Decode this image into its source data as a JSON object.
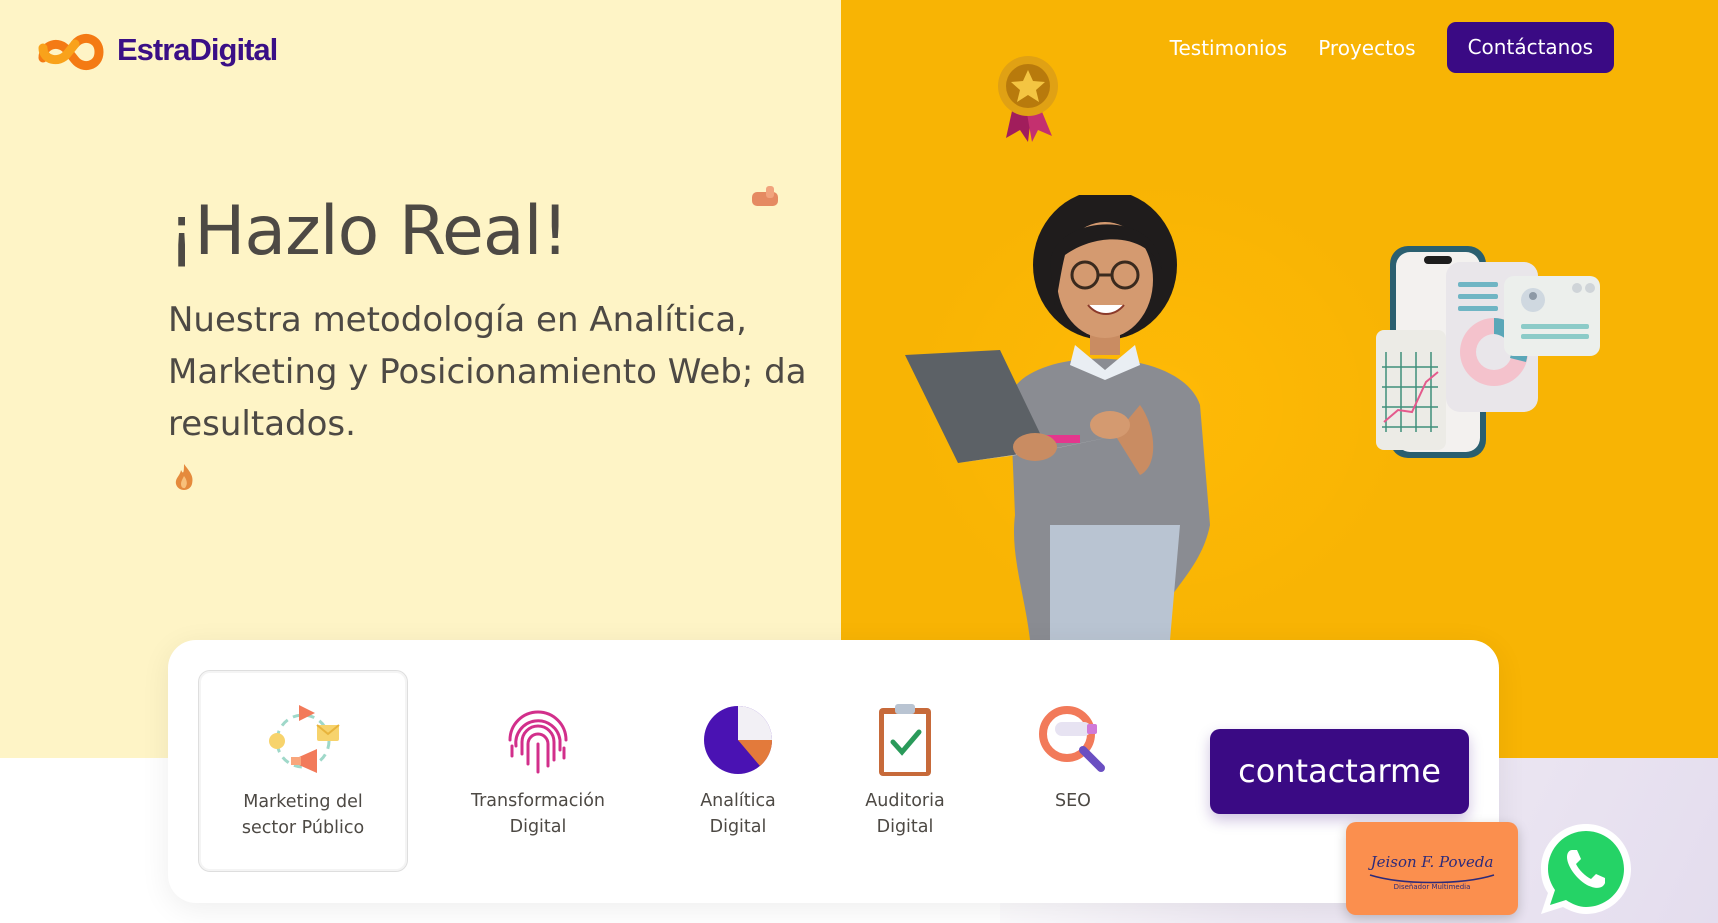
{
  "brand": {
    "name": "EstraDigital",
    "logo_color": "#3a0f86",
    "accent": "#f47a14"
  },
  "nav": {
    "links": [
      "Testimonios",
      "Proyectos"
    ],
    "cta": "Contáctanos"
  },
  "hero": {
    "title": "¡Hazlo Real!",
    "subtitle": "Nuestra metodología en Analítica, Marketing y Posicionamiento Web; da resultados."
  },
  "services": [
    {
      "label": "Marketing del\nsector Público",
      "icon": "megaphone-cycle-icon",
      "active": true
    },
    {
      "label": "Transformación\nDigital",
      "icon": "fingerprint-icon",
      "active": false
    },
    {
      "label": "Analítica\nDigital",
      "icon": "pie-chart-icon",
      "active": false
    },
    {
      "label": "Auditoria\nDigital",
      "icon": "clipboard-check-icon",
      "active": false
    },
    {
      "label": "SEO",
      "icon": "magnifier-icon",
      "active": false
    }
  ],
  "card_cta": "contactarme",
  "signature": {
    "lettering": "Jeison F. Poveda",
    "subtitle": "Diseñador Multimedia"
  },
  "colors": {
    "left_bg": "#fef4c6",
    "right_bg": "#f8b404",
    "primary": "#3a0a84",
    "text": "#4d4944"
  }
}
